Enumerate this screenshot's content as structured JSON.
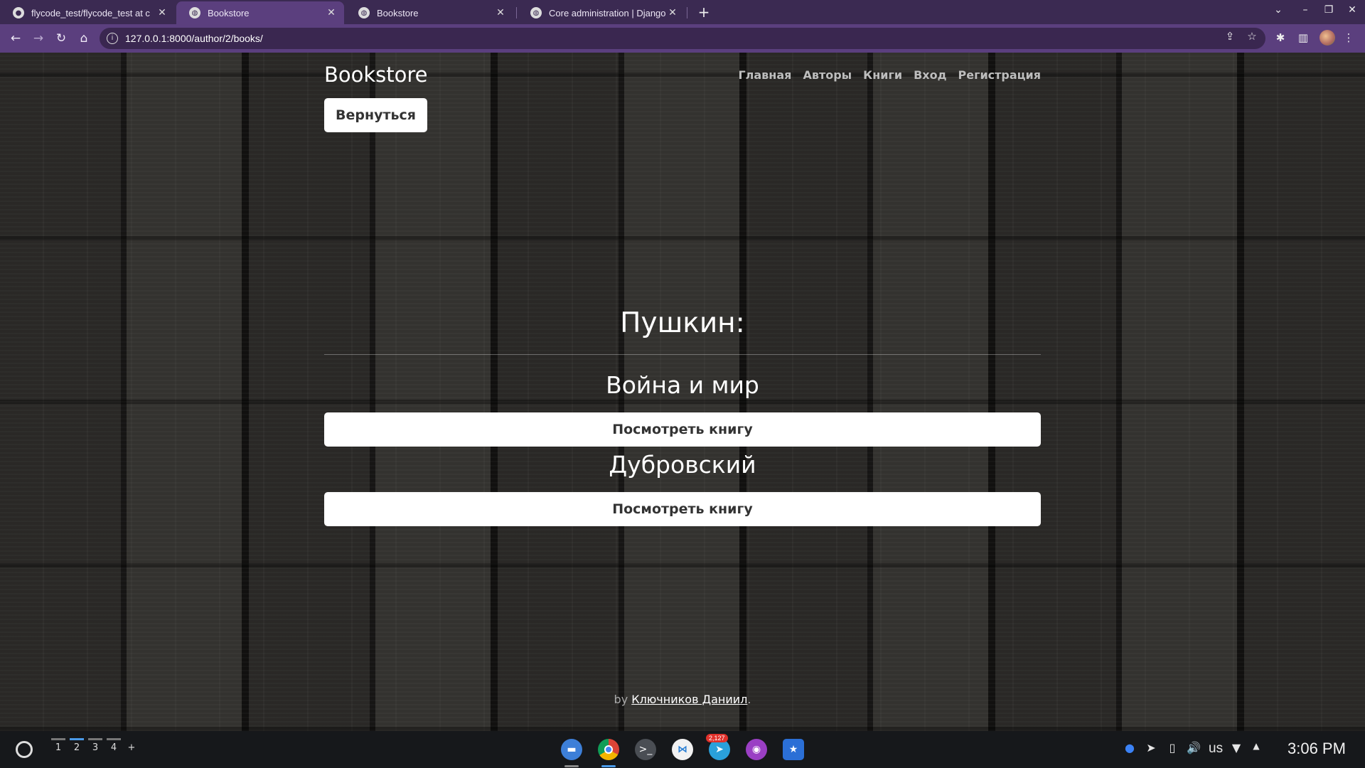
{
  "browser": {
    "tabs": [
      {
        "title": "flycode_test/flycode_test at c",
        "active": false,
        "favicon": "github-icon"
      },
      {
        "title": "Bookstore",
        "active": true,
        "favicon": "globe-icon"
      },
      {
        "title": "Bookstore",
        "active": false,
        "favicon": "globe-icon"
      },
      {
        "title": "Core administration | Django",
        "active": false,
        "favicon": "globe-icon"
      }
    ],
    "url": "127.0.0.1:8000/author/2/books/",
    "theme_color": "#5b3f7e"
  },
  "site": {
    "brand": "Bookstore",
    "nav": [
      "Главная",
      "Авторы",
      "Книги",
      "Вход",
      "Регистрация"
    ],
    "back_button": "Вернуться",
    "author_heading": "Пушкин:",
    "books": [
      {
        "title": "Война и мир",
        "button": "Посмотреть книгу"
      },
      {
        "title": "Дубровский",
        "button": "Посмотреть книгу"
      }
    ],
    "footer": {
      "prefix": "by ",
      "author_link": "Ключников Даниил",
      "suffix": "."
    }
  },
  "taskbar": {
    "desks": [
      "1",
      "2",
      "3",
      "4"
    ],
    "add_desk": "+",
    "apps": [
      "files-icon",
      "chrome-icon",
      "terminal-icon",
      "vscode-icon",
      "telegram-icon",
      "podcast-icon",
      "folder-icon"
    ],
    "telegram_badge": "2,127",
    "keyboard_layout": "us",
    "time": "3:06 PM"
  }
}
